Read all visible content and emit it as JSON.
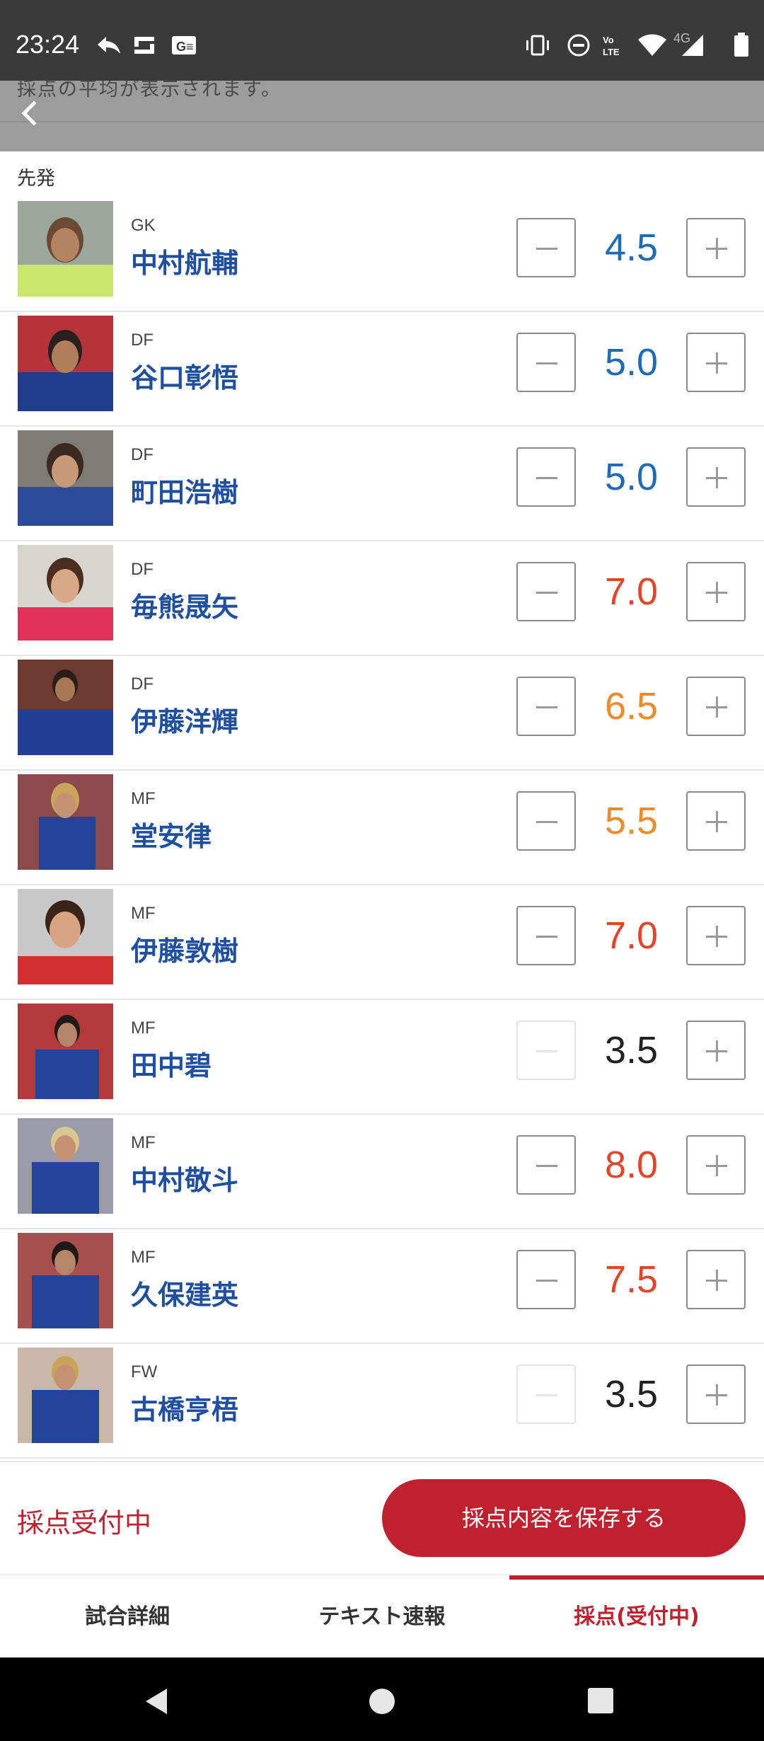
{
  "status_bar": {
    "time": "23:24",
    "network": "4G",
    "icons": [
      "reply-icon",
      "sync-icon",
      "g-news-icon",
      "vibrate-icon",
      "dnd-icon",
      "volte-icon",
      "wifi-icon",
      "signal-icon",
      "battery-icon"
    ]
  },
  "header": {
    "text": "採点の平均が表示されます。"
  },
  "section_label": "先発",
  "players": [
    {
      "position": "GK",
      "name": "中村航輔",
      "score": "4.5",
      "score_color": "#1f6bb5",
      "minus_enabled": true
    },
    {
      "position": "DF",
      "name": "谷口彰悟",
      "score": "5.0",
      "score_color": "#1f6bb5",
      "minus_enabled": true
    },
    {
      "position": "DF",
      "name": "町田浩樹",
      "score": "5.0",
      "score_color": "#1f6bb5",
      "minus_enabled": true
    },
    {
      "position": "DF",
      "name": "毎熊晟矢",
      "score": "7.0",
      "score_color": "#e0462a",
      "minus_enabled": true
    },
    {
      "position": "DF",
      "name": "伊藤洋輝",
      "score": "6.5",
      "score_color": "#ee8a2a",
      "minus_enabled": true
    },
    {
      "position": "MF",
      "name": "堂安律",
      "score": "5.5",
      "score_color": "#ee8a2a",
      "minus_enabled": true
    },
    {
      "position": "MF",
      "name": "伊藤敦樹",
      "score": "7.0",
      "score_color": "#e0462a",
      "minus_enabled": true
    },
    {
      "position": "MF",
      "name": "田中碧",
      "score": "3.5",
      "score_color": "#222222",
      "minus_enabled": false
    },
    {
      "position": "MF",
      "name": "中村敬斗",
      "score": "8.0",
      "score_color": "#e0462a",
      "minus_enabled": true
    },
    {
      "position": "MF",
      "name": "久保建英",
      "score": "7.5",
      "score_color": "#e0462a",
      "minus_enabled": true
    },
    {
      "position": "FW",
      "name": "古橋亨梧",
      "score": "3.5",
      "score_color": "#222222",
      "minus_enabled": false
    }
  ],
  "footer": {
    "status": "採点受付中",
    "save_button": "採点内容を保存する"
  },
  "tabs": [
    {
      "label": "試合詳細",
      "active": false
    },
    {
      "label": "テキスト速報",
      "active": false
    },
    {
      "label": "採点(受付中)",
      "active": true
    }
  ],
  "colors": {
    "accent": "#c0212f",
    "name_blue": "#1f4fa0"
  }
}
